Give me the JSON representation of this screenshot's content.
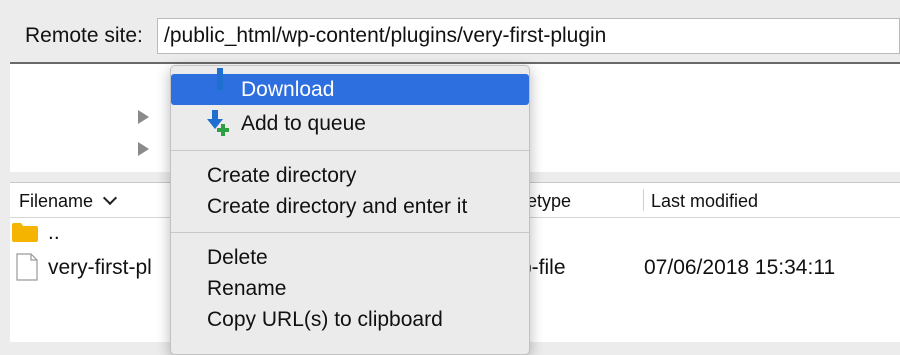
{
  "remote_site": {
    "label": "Remote site:",
    "path": "/public_html/wp-content/plugins/very-first-plugin"
  },
  "file_list": {
    "columns": [
      "Filename",
      "Filetype",
      "Last modified"
    ],
    "columns_visible": [
      "Filename",
      "letype",
      "Last modified"
    ],
    "rows": [
      {
        "name": "..",
        "icon": "folder-icon",
        "type": "",
        "modified": ""
      },
      {
        "name": "very-first-pl",
        "icon": "file-icon",
        "type": "p-file",
        "modified": "07/06/2018 15:34:11"
      }
    ]
  },
  "context_menu": {
    "items": [
      {
        "label": "Download",
        "icon": "download-icon",
        "highlighted": true
      },
      {
        "label": "Add to queue",
        "icon": "add-to-queue-icon"
      },
      {
        "label": "Create directory"
      },
      {
        "label": "Create directory and enter it"
      },
      {
        "label": "Delete"
      },
      {
        "label": "Rename"
      },
      {
        "label": "Copy URL(s) to clipboard"
      }
    ]
  },
  "colors": {
    "highlight": "#2e6fe0",
    "folder": "#f4b400",
    "download_arrow": "#1f6fd1",
    "queue_plus": "#2ea043"
  }
}
